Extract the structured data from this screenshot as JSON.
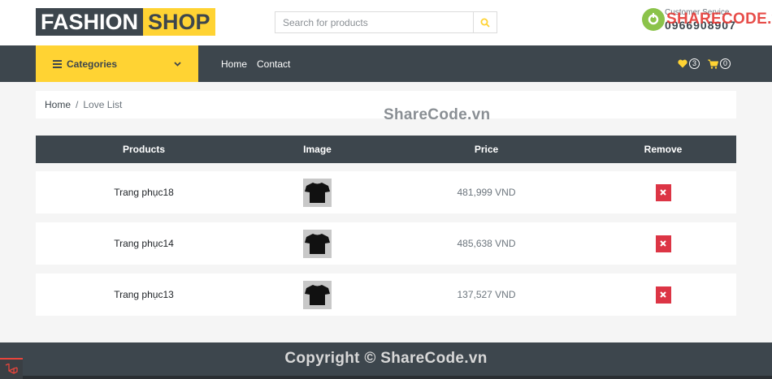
{
  "brand": {
    "part1": "FASHION",
    "part2": "SHOP"
  },
  "search": {
    "placeholder": "Search for products",
    "icon": "search-icon"
  },
  "customer_service": {
    "label": "Customer Service",
    "phone": "0966908907"
  },
  "watermark": {
    "logo_text": "SHARECODE.vn",
    "center": "ShareCode.vn",
    "footer": "Copyright © ShareCode.vn"
  },
  "nav": {
    "categories_label": "Categories",
    "links": [
      "Home",
      "Contact"
    ],
    "wishlist_count": "3",
    "cart_count": "0"
  },
  "breadcrumb": {
    "home": "Home",
    "separator": "/",
    "current": "Love List"
  },
  "table": {
    "headers": [
      "Products",
      "Image",
      "Price",
      "Remove"
    ],
    "rows": [
      {
        "name": "Trang phục18",
        "price": "481,999 VND"
      },
      {
        "name": "Trang phục14",
        "price": "485,638 VND"
      },
      {
        "name": "Trang phục13",
        "price": "137,527 VND"
      }
    ]
  },
  "colors": {
    "dark": "#3d464d",
    "accent": "#ffd333",
    "danger": "#dc3545",
    "background": "#f5f5f5"
  }
}
